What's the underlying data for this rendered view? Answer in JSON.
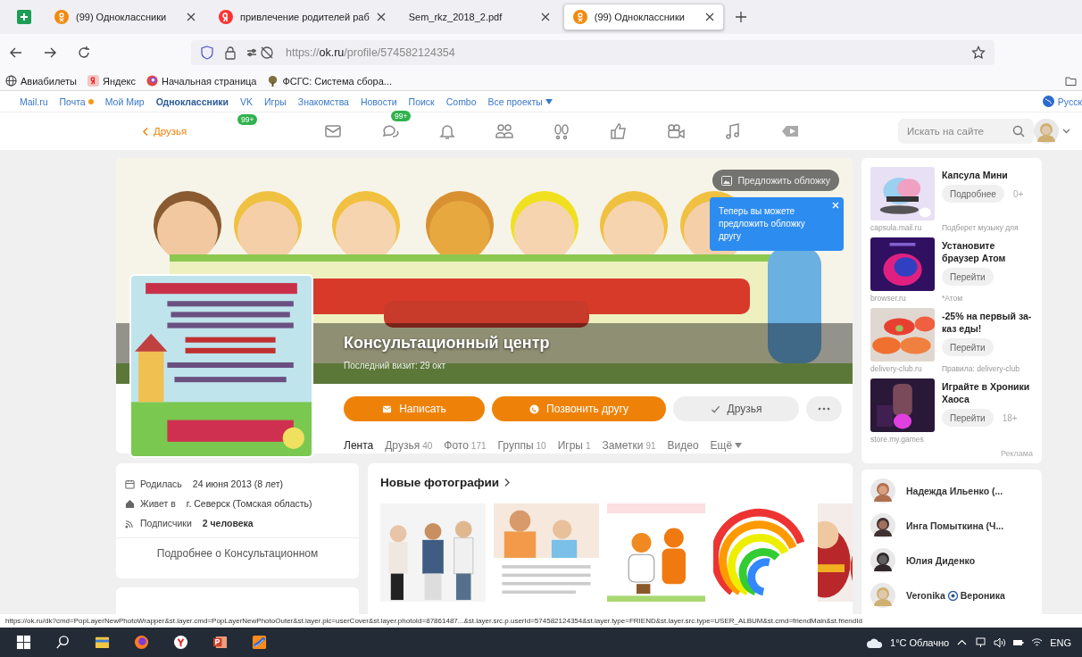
{
  "browser": {
    "tabs": [
      {
        "kind": "sheets",
        "selected": false
      },
      {
        "kind": "ok",
        "title": "(99) Одноклассники",
        "selected": false
      },
      {
        "kind": "yandex",
        "title": "привлечение родителей раб",
        "selected": false
      },
      {
        "kind": "doc",
        "title": "Sem_rkz_2018_2.pdf",
        "selected": false
      },
      {
        "kind": "ok",
        "title": "(99) Одноклассники",
        "selected": true
      }
    ],
    "url": {
      "scheme": "https://",
      "host": "ok.ru",
      "path": "/profile/574582124354"
    },
    "bookmarks": [
      {
        "label": "Авиабилеты"
      },
      {
        "label": "Яндекс"
      },
      {
        "label": "Начальная страница"
      },
      {
        "label": "ФСГС: Система сбора..."
      }
    ]
  },
  "portal": {
    "links": [
      {
        "label": "Mail.ru",
        "selected": false,
        "unread": false
      },
      {
        "label": "Почта",
        "selected": false,
        "unread": true
      },
      {
        "label": "Мой Мир",
        "selected": false,
        "unread": false
      },
      {
        "label": "Одноклассники",
        "selected": true,
        "unread": false
      },
      {
        "label": "VK",
        "selected": false,
        "unread": false
      },
      {
        "label": "Игры",
        "selected": false,
        "unread": false
      },
      {
        "label": "Знакомства",
        "selected": false,
        "unread": false
      },
      {
        "label": "Новости",
        "selected": false,
        "unread": false
      },
      {
        "label": "Поиск",
        "selected": false,
        "unread": false
      },
      {
        "label": "Combo",
        "selected": false,
        "unread": false
      }
    ],
    "all_projects": "Все проекты",
    "language": "Русск"
  },
  "ok_bar": {
    "back": "Друзья",
    "back_badge": "99+",
    "icons": [
      {
        "kind": "mail"
      },
      {
        "kind": "chat",
        "badge": "99+"
      },
      {
        "kind": "bell"
      },
      {
        "kind": "friends"
      },
      {
        "kind": "guests"
      },
      {
        "kind": "likes"
      },
      {
        "kind": "video_call"
      },
      {
        "kind": "music"
      },
      {
        "kind": "video"
      }
    ],
    "search_placeholder": "Искать на сайте"
  },
  "profile": {
    "name": "Консультационный центр",
    "last_visit": "Последний визит: 29 окт",
    "suggest_cover": "Предложить обложку",
    "tooltip": "Теперь вы можете предложить обложку другу",
    "actions": [
      {
        "kind": "message",
        "label": "Написать"
      },
      {
        "kind": "call",
        "label": "Позвонить другу"
      },
      {
        "kind": "friends",
        "label": "Друзья"
      },
      {
        "kind": "more"
      }
    ],
    "tabs": [
      {
        "label": "Лента",
        "selected": true,
        "dropdown": false
      },
      {
        "label": "Друзья",
        "count": "40",
        "selected": false,
        "dropdown": false
      },
      {
        "label": "Фото",
        "count": "171",
        "selected": false,
        "dropdown": false
      },
      {
        "label": "Группы",
        "count": "10",
        "selected": false,
        "dropdown": false
      },
      {
        "label": "Игры",
        "count": "1",
        "selected": false,
        "dropdown": false
      },
      {
        "label": "Заметки",
        "count": "91",
        "selected": false,
        "dropdown": false
      },
      {
        "label": "Видео",
        "selected": false,
        "dropdown": false
      },
      {
        "label": "Ещё",
        "selected": false,
        "dropdown": true
      }
    ]
  },
  "about": {
    "rows": [
      {
        "kind": "born",
        "label": "Родилась",
        "value": "24 июня 2013 (8 лет)",
        "emphasis": false
      },
      {
        "kind": "lives",
        "label": "Живет в",
        "value": "г. Северск (Томская область)",
        "emphasis": false
      },
      {
        "kind": "subscribers",
        "label": "Подписчики",
        "value": "2 человека",
        "emphasis": true
      }
    ],
    "more": "Подробнее о Консультационном"
  },
  "photos": {
    "title": "Новые фотографии"
  },
  "ads": {
    "items": [
      {
        "title": "Капсула Мини",
        "button": "Подробнее",
        "age": "0+",
        "domain": "capsula.mail.ru",
        "note": "Подберет музыку для"
      },
      {
        "title": "Установите браузер Атом",
        "button": "Перейти",
        "domain": "browser.ru",
        "note": "*Атом"
      },
      {
        "title": "-25% на первый за-каз еды!",
        "button": "Перейти",
        "domain": "delivery-club.ru",
        "note": "Правила: delivery-club"
      },
      {
        "title": "Играйте в Хроники Хаоса",
        "button": "Перейти",
        "age": "18+",
        "domain": "store.my.games"
      }
    ],
    "footer": "Реклама"
  },
  "friends": [
    {
      "name": "Надежда Ильенко (..."
    },
    {
      "name": "Инга Помыткина (Ч..."
    },
    {
      "name": "Юлия Диденко"
    },
    {
      "name": "Veronika",
      "alias": "Вероника"
    }
  ],
  "status_url": "https://ok.ru/dk?cmd=PopLayerNewPhotoWrapper&st.layer.cmd=PopLayerNewPhotoOuter&st.layer.plc=userCover&st.layer.photoId=87861487...&st.layer.src.p.userId=574582124354&st.layer.type=FRIEND&st.layer.src.type=USER_ALBUM&st.cmd=friendMain&st.friendId",
  "taskbar": {
    "apps": [
      {
        "kind": "start"
      },
      {
        "kind": "search"
      },
      {
        "kind": "explorer"
      },
      {
        "kind": "firefox"
      },
      {
        "kind": "yandex"
      },
      {
        "kind": "powerpoint"
      },
      {
        "kind": "app"
      }
    ],
    "weather": "1°C Облачно",
    "language": "ENG"
  }
}
